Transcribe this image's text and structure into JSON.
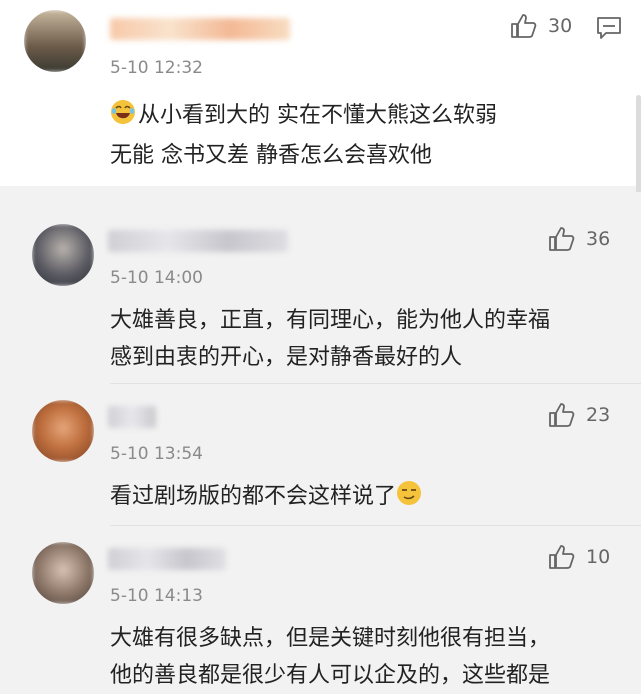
{
  "comments": [
    {
      "time": "5-10 12:32",
      "likes": "30",
      "text_lines": [
        "从小看到大的 实在不懂大熊这么软弱",
        "无能 念书又差  静香怎么会喜欢他"
      ],
      "emoji": "laughing-crying-emoji"
    },
    {
      "time": "5-10 14:00",
      "likes": "36",
      "text_lines": [
        "大雄善良，正直，有同理心，能为他人的幸福",
        "感到由衷的开心，是对静香最好的人"
      ]
    },
    {
      "time": "5-10 13:54",
      "likes": "23",
      "text_lines": [
        "看过剧场版的都不会这样说了"
      ],
      "emoji": "smirk-emoji"
    },
    {
      "time": "5-10 14:13",
      "likes": "10",
      "text_lines": [
        "大雄有很多缺点，但是关键时刻他很有担当，",
        "他的善良都是很少有人可以企及的，这些都是"
      ]
    }
  ],
  "icons": {
    "like": "thumbs-up-icon",
    "reply": "comment-bubble-icon"
  },
  "colors": {
    "main_bg": "#ffffff",
    "reply_bg": "#f2f2f2",
    "meta_text": "#8a8a8a"
  }
}
